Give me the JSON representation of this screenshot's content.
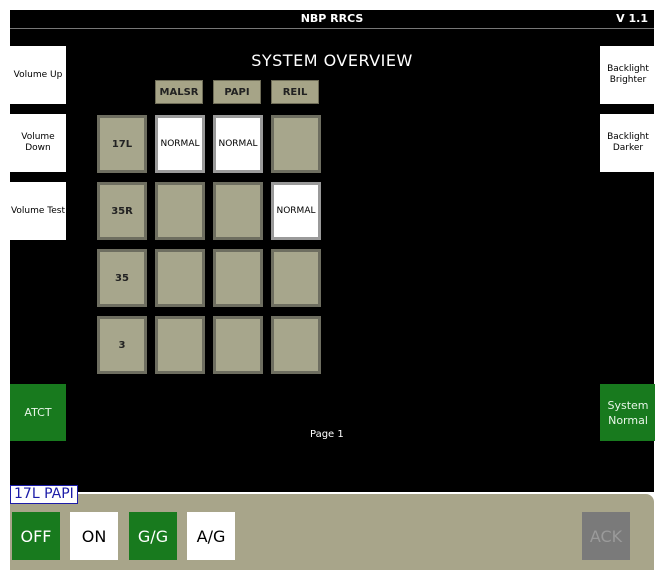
{
  "app": {
    "title": "NBP RRCS",
    "version": "V 1.1"
  },
  "overview": {
    "heading": "SYSTEM OVERVIEW",
    "page_label": "Page 1"
  },
  "left_buttons": {
    "volume_up": "Volume Up",
    "volume_down": "Volume\nDown",
    "volume_test": "Volume Test",
    "atct": "ATCT"
  },
  "right_buttons": {
    "backlight_brighter": "Backlight\nBrighter",
    "backlight_darker": "Backlight\nDarker",
    "system_normal": "System\nNormal"
  },
  "grid": {
    "columns": [
      "MALSR",
      "PAPI",
      "REIL"
    ],
    "rows": [
      {
        "label": "17L",
        "cells": [
          "NORMAL",
          "NORMAL",
          ""
        ]
      },
      {
        "label": "35R",
        "cells": [
          "",
          "",
          "NORMAL"
        ]
      },
      {
        "label": "35",
        "cells": [
          "",
          "",
          ""
        ]
      },
      {
        "label": "3",
        "cells": [
          "",
          "",
          ""
        ]
      }
    ]
  },
  "control": {
    "selected": "17L PAPI",
    "buttons": {
      "off": "OFF",
      "on": "ON",
      "gg": "G/G",
      "ag": "A/G",
      "ack": "ACK"
    },
    "active_buttons": [
      "OFF",
      "G/G"
    ]
  },
  "colors": {
    "accent_green": "#187a1e",
    "panel_tan": "#a8a58a",
    "cell_tan": "#a7a68c",
    "label_blue": "#1c1ca8"
  }
}
